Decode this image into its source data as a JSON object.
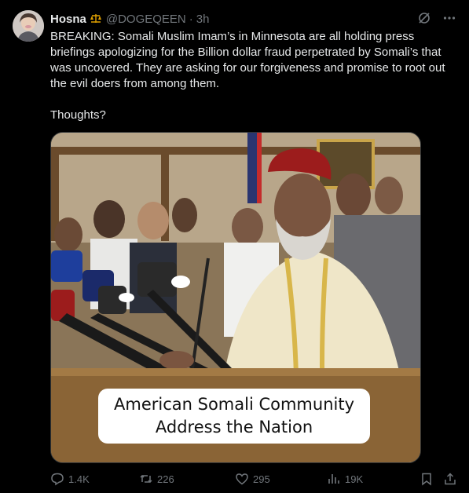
{
  "post": {
    "author_name": "Hosna",
    "author_handle": "@DOGEQEEN",
    "separator": "·",
    "time": "3h",
    "badge_icon": "scales-icon",
    "text_paragraph_1": "BREAKING: Somali Muslim Imam’s in Minnesota are all holding press briefings apologizing for the Billion dollar fraud perpetrated by Somali’s that was uncovered. They are asking for our forgiveness and promise to root out the evil doers from among them.",
    "text_paragraph_2": "Thoughts?"
  },
  "media": {
    "caption_line_1": "American Somali Community",
    "caption_line_2": "Address the Nation"
  },
  "actions": {
    "replies": "1.4K",
    "reposts": "226",
    "likes": "295",
    "views": "19K"
  },
  "colors": {
    "background": "#000000",
    "text": "#e7e9ea",
    "muted": "#71767b",
    "badge": "#e0a100"
  }
}
